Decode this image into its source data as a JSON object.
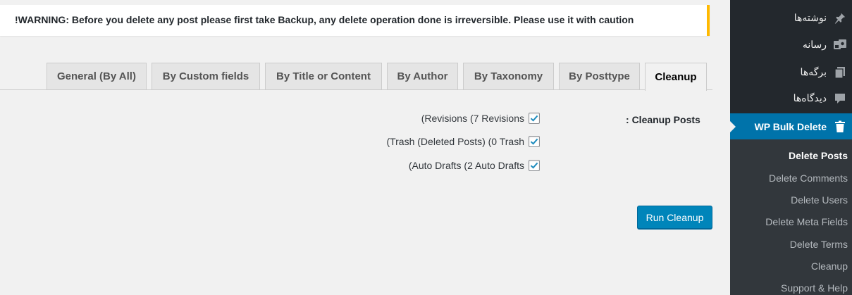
{
  "notice": {
    "text": "!WARNING: Before you delete any post please first take Backup, any delete operation done is irreversible. Please use it with caution",
    "accent_color": "#ffb900"
  },
  "tabs": [
    {
      "label": "General (By All)",
      "active": false
    },
    {
      "label": "By Custom fields",
      "active": false
    },
    {
      "label": "By Title or Content",
      "active": false
    },
    {
      "label": "By Author",
      "active": false
    },
    {
      "label": "By Taxonomy",
      "active": false
    },
    {
      "label": "By Posttype",
      "active": false
    },
    {
      "label": "Cleanup",
      "active": true
    }
  ],
  "cleanup": {
    "section_label": "Cleanup Posts :",
    "options": [
      {
        "label": "(Revisions (7 Revisions",
        "checked": true
      },
      {
        "label": "(Trash (Deleted Posts) (0 Trash",
        "checked": true
      },
      {
        "label": "(Auto Drafts (2 Auto Drafts",
        "checked": true
      }
    ],
    "run_button": "Run Cleanup"
  },
  "sidebar": {
    "menu": [
      {
        "label": "نوشته‌ها",
        "icon": "pin-icon"
      },
      {
        "label": "رسانه",
        "icon": "media-icon"
      },
      {
        "label": "برگه‌ها",
        "icon": "pages-icon"
      },
      {
        "label": "دیدگاه‌ها",
        "icon": "comment-icon"
      },
      {
        "label": "WP Bulk Delete",
        "icon": "trash-icon",
        "current": true
      }
    ],
    "submenu": [
      {
        "label": "Delete Posts",
        "active": true
      },
      {
        "label": "Delete Comments"
      },
      {
        "label": "Delete Users"
      },
      {
        "label": "Delete Meta Fields"
      },
      {
        "label": "Delete Terms"
      },
      {
        "label": "Cleanup"
      },
      {
        "label": "Support & Help"
      }
    ],
    "colors": {
      "background": "#23282d",
      "current": "#0073aa",
      "submenu_bg": "#32373c"
    }
  }
}
